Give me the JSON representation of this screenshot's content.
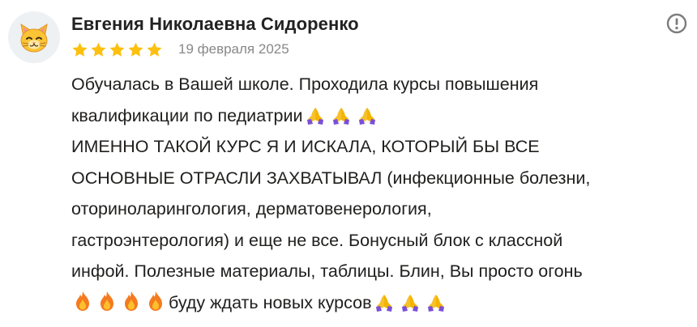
{
  "review": {
    "author": "Евгения Николаевна Сидоренко",
    "avatar_icon": "cat-face-icon",
    "rating": 5,
    "rating_max": 5,
    "date": "19 февраля 2025",
    "report_icon": "exclamation-circle-icon",
    "lines": {
      "l1": "Обучалась в Вашей школе. Проходила курсы повышения",
      "l2": "квалификации по педиатрии",
      "l3": "ИМЕННО ТАКОЙ КУРС Я И ИСКАЛА, КОТОРЫЙ БЫ ВСЕ",
      "l4": "ОСНОВНЫЕ ОТРАСЛИ ЗАХВАТЫВАЛ (инфекционные болезни,",
      "l5": "оториноларингология, дерматовенерология,",
      "l6": "гастроэнтерология) и еще не все. Бонусный блок с классной",
      "l7": "инфой. Полезные материалы, таблицы. Блин, Вы просто огонь",
      "l8": "буду ждать новых курсов"
    },
    "emoji": {
      "praying_hands": "folded-hands-icon",
      "fire": "fire-icon"
    },
    "colors": {
      "star": "#fdc00f",
      "date": "#888888",
      "text": "#21201f",
      "report_icon": "#7d7d7d",
      "avatar_bg": "#eef1f4"
    }
  }
}
